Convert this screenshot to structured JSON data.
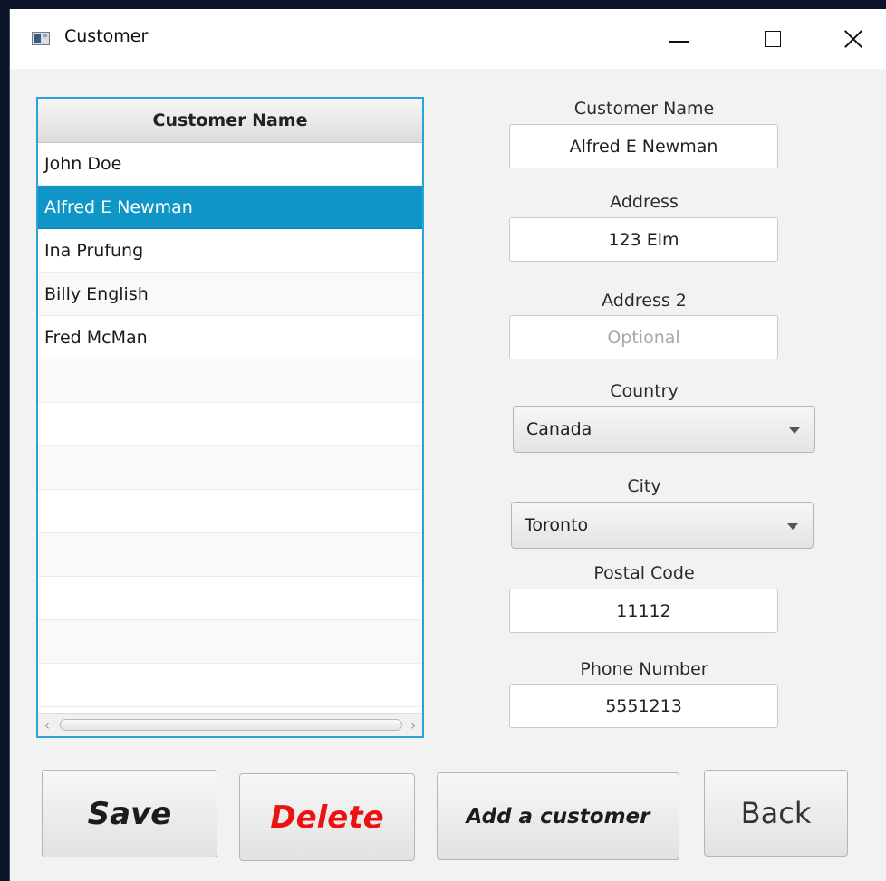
{
  "window": {
    "title": "Customer"
  },
  "table": {
    "header": "Customer Name",
    "rows": [
      "John Doe",
      "Alfred E Newman",
      "Ina Prufung",
      "Billy English",
      "Fred McMan"
    ],
    "selected_row": "Alfred E Newman"
  },
  "form": {
    "customer_name": {
      "label": "Customer Name",
      "value": "Alfred E Newman"
    },
    "address": {
      "label": "Address",
      "value": "123 Elm"
    },
    "address2": {
      "label": "Address 2",
      "value": "",
      "placeholder": "Optional"
    },
    "country": {
      "label": "Country",
      "value": "Canada"
    },
    "city": {
      "label": "City",
      "value": "Toronto"
    },
    "postal_code": {
      "label": "Postal Code",
      "value": "11112"
    },
    "phone": {
      "label": "Phone Number",
      "value": "5551213"
    }
  },
  "buttons": {
    "save": "Save",
    "delete": "Delete",
    "add": "Add a customer",
    "back": "Back"
  },
  "colors": {
    "selection": "#0f96c7",
    "table_focus_border": "#2aa3d9",
    "delete_text": "#ee1111"
  },
  "icons": [
    "app-window-icon",
    "minimize-icon",
    "maximize-icon",
    "close-icon",
    "scroll-left-icon",
    "scroll-right-icon",
    "dropdown-caret-icon"
  ]
}
